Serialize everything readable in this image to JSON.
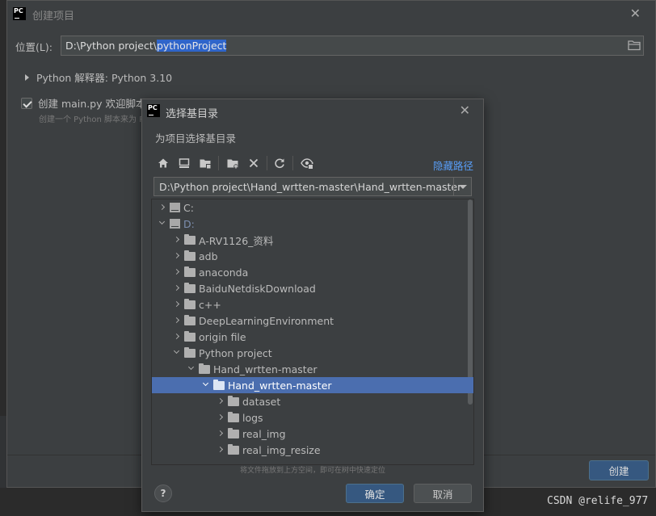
{
  "main": {
    "title": "创建项目",
    "location_label": "位置(L):",
    "location_prefix": "D:\\Python project\\",
    "location_selected": "pythonProject",
    "interpreter_label": "Python 解释器: Python 3.10",
    "welcome_label": "创建 main.py 欢迎脚本",
    "welcome_desc": "创建一个 Python 脚本来为 P",
    "create_button": "创建"
  },
  "dialog": {
    "title": "选择基目录",
    "subtitle": "为项目选择基目录",
    "hide_path": "隐藏路径",
    "path": "D:\\Python project\\Hand_wrtten-master\\Hand_wrtten-master",
    "hint": "将文件拖放到上方空间，即可在树中快速定位",
    "ok_button": "确定",
    "cancel_button": "取消",
    "toolbar_icons": [
      "home-icon",
      "desktop-icon",
      "project-folder-icon",
      "new-folder-icon",
      "delete-icon",
      "refresh-icon",
      "show-hidden-icon"
    ]
  },
  "tree": [
    {
      "label": "C:",
      "expanded": false,
      "kind": "drive"
    },
    {
      "label": "D:",
      "expanded": true,
      "kind": "drive"
    },
    {
      "label": "A-RV1126_资料",
      "expanded": false,
      "kind": "folder"
    },
    {
      "label": "adb",
      "expanded": false,
      "kind": "folder"
    },
    {
      "label": "anaconda",
      "expanded": false,
      "kind": "folder"
    },
    {
      "label": "BaiduNetdiskDownload",
      "expanded": false,
      "kind": "folder"
    },
    {
      "label": "c++",
      "expanded": false,
      "kind": "folder"
    },
    {
      "label": "DeepLearningEnvironment",
      "expanded": false,
      "kind": "folder"
    },
    {
      "label": "origin file",
      "expanded": false,
      "kind": "folder"
    },
    {
      "label": "Python project",
      "expanded": true,
      "kind": "folder"
    },
    {
      "label": "Hand_wrtten-master",
      "expanded": true,
      "kind": "folder"
    },
    {
      "label": "Hand_wrtten-master",
      "expanded": true,
      "kind": "folder",
      "selected": true
    },
    {
      "label": "dataset",
      "expanded": false,
      "kind": "folder"
    },
    {
      "label": "logs",
      "expanded": false,
      "kind": "folder"
    },
    {
      "label": "real_img",
      "expanded": false,
      "kind": "folder"
    },
    {
      "label": "real_img_resize",
      "expanded": false,
      "kind": "folder"
    }
  ],
  "watermark": "CSDN @relife_977",
  "colors": {
    "accent": "#4b6eaf",
    "link": "#589df6",
    "button_primary": "#365880"
  }
}
